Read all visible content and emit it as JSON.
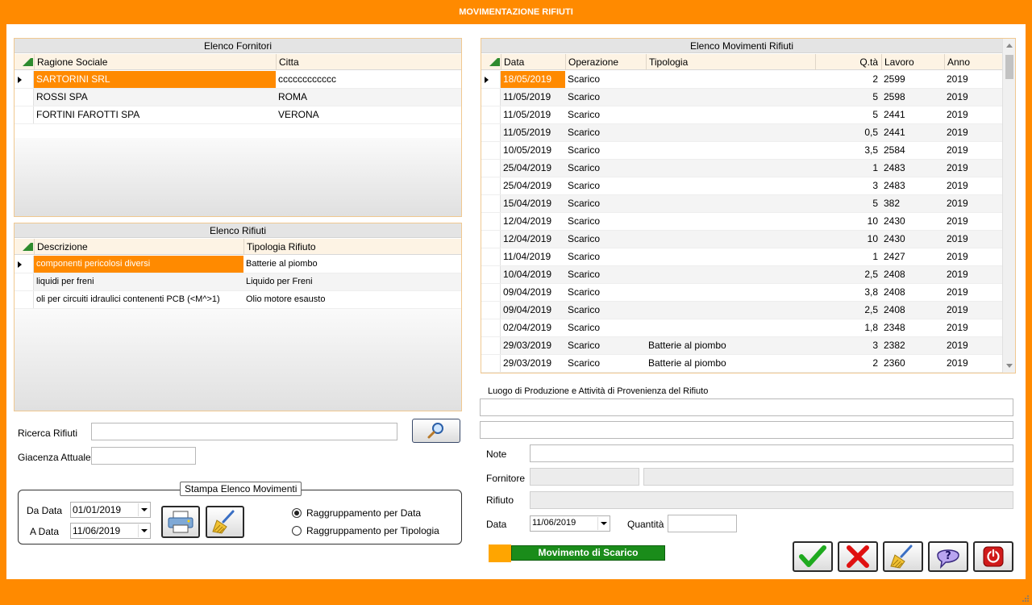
{
  "window": {
    "title": "MOVIMENTAZIONE RIFIUTI"
  },
  "fornitori": {
    "caption": "Elenco Fornitori",
    "columns": [
      "Ragione Sociale",
      "Citta"
    ],
    "rows": [
      {
        "ragione": "SARTORINI SRL",
        "citta": "cccccccccccc"
      },
      {
        "ragione": "ROSSI SPA",
        "citta": "ROMA"
      },
      {
        "ragione": "FORTINI FAROTTI SPA",
        "citta": "VERONA"
      }
    ]
  },
  "rifiuti": {
    "caption": "Elenco Rifiuti",
    "columns": [
      "Descrizione",
      "Tipologia Rifiuto"
    ],
    "rows": [
      {
        "descrizione": "componenti pericolosi diversi",
        "tipologia": "Batterie al piombo"
      },
      {
        "descrizione": "liquidi per freni",
        "tipologia": "Liquido per Freni"
      },
      {
        "descrizione": "oli per circuiti idraulici contenenti PCB (<M^>1)",
        "tipologia": "Olio motore esausto"
      }
    ]
  },
  "movimenti": {
    "caption": "Elenco Movimenti Rifiuti",
    "columns": [
      "Data",
      "Operazione",
      "Tipologia",
      "Q.tà",
      "Lavoro",
      "Anno"
    ],
    "rows": [
      {
        "data": "18/05/2019",
        "op": "Scarico",
        "tip": "",
        "qta": "2",
        "lavoro": "2599",
        "anno": "2019"
      },
      {
        "data": "11/05/2019",
        "op": "Scarico",
        "tip": "",
        "qta": "5",
        "lavoro": "2598",
        "anno": "2019"
      },
      {
        "data": "11/05/2019",
        "op": "Scarico",
        "tip": "",
        "qta": "5",
        "lavoro": "2441",
        "anno": "2019"
      },
      {
        "data": "11/05/2019",
        "op": "Scarico",
        "tip": "",
        "qta": "0,5",
        "lavoro": "2441",
        "anno": "2019"
      },
      {
        "data": "10/05/2019",
        "op": "Scarico",
        "tip": "",
        "qta": "3,5",
        "lavoro": "2584",
        "anno": "2019"
      },
      {
        "data": "25/04/2019",
        "op": "Scarico",
        "tip": "",
        "qta": "1",
        "lavoro": "2483",
        "anno": "2019"
      },
      {
        "data": "25/04/2019",
        "op": "Scarico",
        "tip": "",
        "qta": "3",
        "lavoro": "2483",
        "anno": "2019"
      },
      {
        "data": "15/04/2019",
        "op": "Scarico",
        "tip": "",
        "qta": "5",
        "lavoro": "382",
        "anno": "2019"
      },
      {
        "data": "12/04/2019",
        "op": "Scarico",
        "tip": "",
        "qta": "10",
        "lavoro": "2430",
        "anno": "2019"
      },
      {
        "data": "12/04/2019",
        "op": "Scarico",
        "tip": "",
        "qta": "10",
        "lavoro": "2430",
        "anno": "2019"
      },
      {
        "data": "11/04/2019",
        "op": "Scarico",
        "tip": "",
        "qta": "1",
        "lavoro": "2427",
        "anno": "2019"
      },
      {
        "data": "10/04/2019",
        "op": "Scarico",
        "tip": "",
        "qta": "2,5",
        "lavoro": "2408",
        "anno": "2019"
      },
      {
        "data": "09/04/2019",
        "op": "Scarico",
        "tip": "",
        "qta": "3,8",
        "lavoro": "2408",
        "anno": "2019"
      },
      {
        "data": "09/04/2019",
        "op": "Scarico",
        "tip": "",
        "qta": "2,5",
        "lavoro": "2408",
        "anno": "2019"
      },
      {
        "data": "02/04/2019",
        "op": "Scarico",
        "tip": "",
        "qta": "1,8",
        "lavoro": "2348",
        "anno": "2019"
      },
      {
        "data": "29/03/2019",
        "op": "Scarico",
        "tip": "Batterie al piombo",
        "qta": "3",
        "lavoro": "2382",
        "anno": "2019"
      },
      {
        "data": "29/03/2019",
        "op": "Scarico",
        "tip": "Batterie al piombo",
        "qta": "2",
        "lavoro": "2360",
        "anno": "2019"
      }
    ]
  },
  "ricerca": {
    "label_ricerca": "Ricerca Rifiuti",
    "ricerca_value": "",
    "label_giacenza": "Giacenza Attuale",
    "giacenza_value": ""
  },
  "stampa": {
    "title": "Stampa Elenco Movimenti",
    "label_da": "Da Data",
    "da_value": "01/01/2019",
    "label_a": "A Data",
    "a_value": "11/06/2019",
    "radio_data": "Raggruppamento per Data",
    "radio_tipologia": "Raggruppamento per Tipologia",
    "selected": "data"
  },
  "dettaglio": {
    "luogo_label": "Luogo di Produzione e Attività di Provenienza del Rifiuto",
    "luogo_1": "",
    "luogo_2": "",
    "note_label": "Note",
    "note_value": "",
    "fornitore_label": "Fornitore",
    "fornitore_code": "",
    "fornitore_name": "",
    "rifiuto_label": "Rifiuto",
    "rifiuto_value": "",
    "data_label": "Data",
    "data_value": "11/06/2019",
    "quantita_label": "Quantità",
    "quantita_value": "",
    "movimento_label": "Movimento di Scarico"
  },
  "colors": {
    "accent": "#ff8a00",
    "movimento": "#1a8c1a",
    "confirm": "#1faa1f",
    "cancel": "#e01010"
  },
  "icons": [
    "search-icon",
    "printer-icon",
    "broom-icon",
    "check-icon",
    "cross-icon",
    "help-icon",
    "power-icon"
  ]
}
